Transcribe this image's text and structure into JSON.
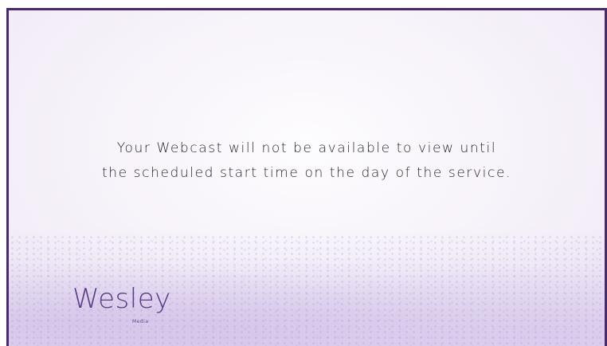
{
  "message": {
    "line1": "Your Webcast will not be available to view until",
    "line2": "the scheduled start time on the day of the service."
  },
  "logo": {
    "word": "Wesley",
    "subtext": "Media"
  },
  "colors": {
    "border": "#4a2a6e",
    "logo": "#5a3d86",
    "text": "#2a2530"
  }
}
